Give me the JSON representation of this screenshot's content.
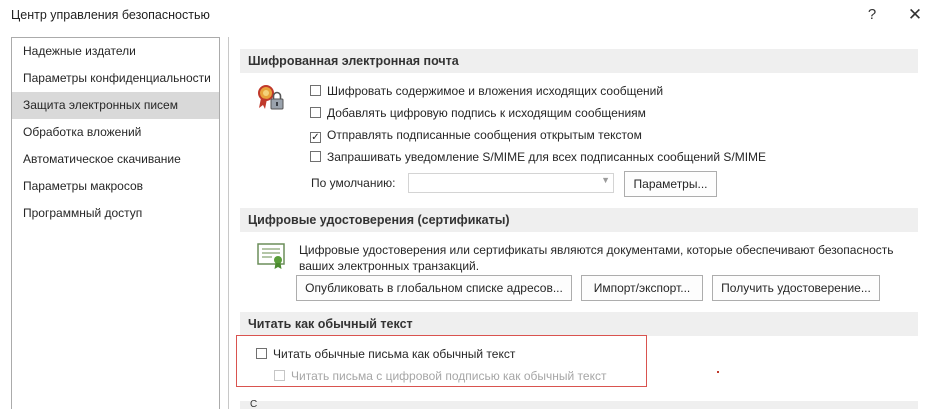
{
  "window": {
    "title": "Центр управления безопасностью",
    "help_glyph": "?",
    "close_glyph": "✕"
  },
  "sidebar": {
    "items": [
      {
        "label": "Надежные издатели",
        "selected": false
      },
      {
        "label": "Параметры конфиденциальности",
        "selected": false
      },
      {
        "label": "Защита электронных писем",
        "selected": true
      },
      {
        "label": "Обработка вложений",
        "selected": false
      },
      {
        "label": "Автоматическое скачивание",
        "selected": false
      },
      {
        "label": "Параметры макросов",
        "selected": false
      },
      {
        "label": "Программный доступ",
        "selected": false
      }
    ]
  },
  "encrypted_mail": {
    "header": "Шифрованная электронная почта",
    "icon": "certificate-lock-icon",
    "options": [
      {
        "label": "Шифровать содержимое и вложения исходящих сообщений",
        "checked": false
      },
      {
        "label": "Добавлять цифровую подпись к исходящим сообщениям",
        "checked": false
      },
      {
        "label": "Отправлять подписанные сообщения открытым текстом",
        "checked": true
      },
      {
        "label": "Запрашивать уведомление S/MIME для всех подписанных сообщений S/MIME",
        "checked": false
      }
    ],
    "default_label": "По умолчанию:",
    "default_value": "",
    "settings_button": "Параметры..."
  },
  "certificates": {
    "header": "Цифровые удостоверения (сертификаты)",
    "icon": "certificate-icon",
    "description_line1": "Цифровые удостоверения или сертификаты являются документами, которые обеспечивают безопасность",
    "description_line2": "ваших электронных транзакций.",
    "publish_button": "Опубликовать в глобальном списке адресов...",
    "import_export_button": "Импорт/экспорт...",
    "get_id_button": "Получить удостоверение..."
  },
  "plain_text": {
    "header": "Читать как обычный текст",
    "read_all_label": "Читать обычные письма как обычный текст",
    "read_all_checked": false,
    "read_signed_label": "Читать письма с цифровой подписью как обычный текст",
    "read_signed_checked": false,
    "read_signed_enabled": false
  },
  "next_section_header_partial": "С",
  "colors": {
    "section_header_bg": "#efefef",
    "selected_item_bg": "#d9d9d9",
    "highlight_border": "#d9534f",
    "disabled_text": "#a6a6a6"
  }
}
